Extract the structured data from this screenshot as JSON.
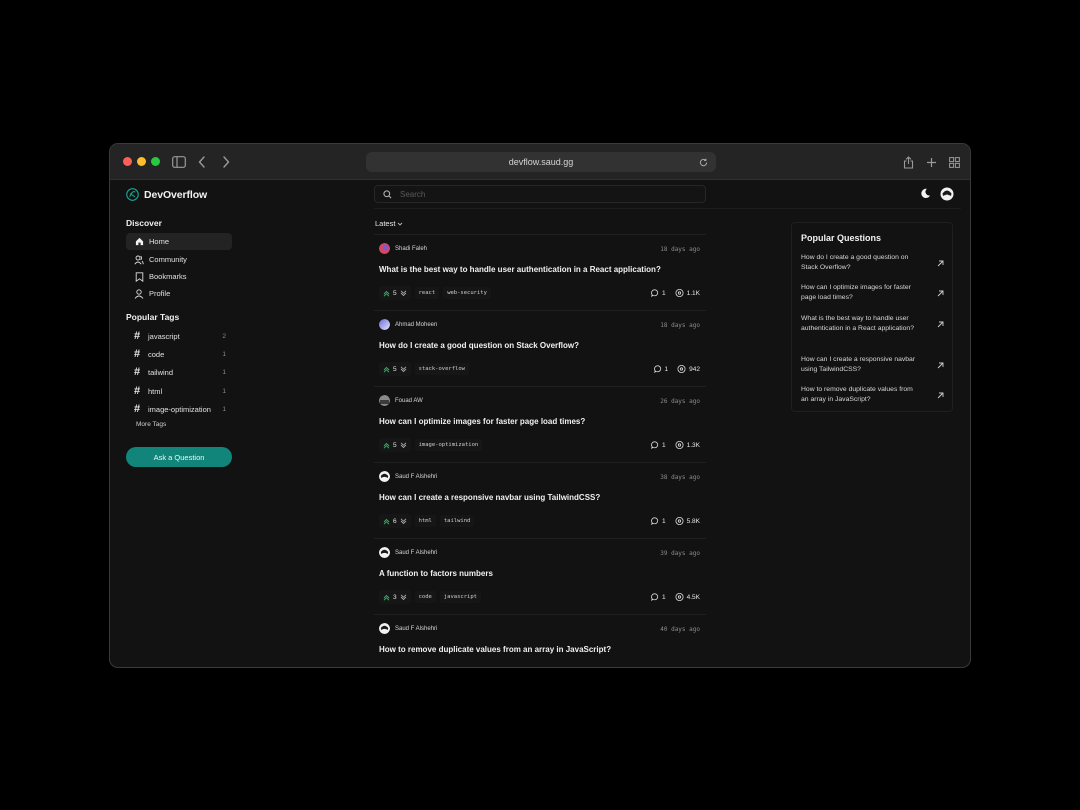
{
  "browser": {
    "url": "devflow.saud.gg"
  },
  "app": {
    "name": "DevOverflow",
    "search_placeholder": "Search"
  },
  "sidebar": {
    "discover_heading": "Discover",
    "nav": [
      {
        "label": "Home",
        "icon": "home-icon",
        "active": true
      },
      {
        "label": "Community",
        "icon": "users-icon",
        "active": false
      },
      {
        "label": "Bookmarks",
        "icon": "bookmark-icon",
        "active": false
      },
      {
        "label": "Profile",
        "icon": "user-icon",
        "active": false
      }
    ],
    "tags_heading": "Popular Tags",
    "tags": [
      {
        "name": "javascript",
        "count": "2"
      },
      {
        "name": "code",
        "count": "1"
      },
      {
        "name": "tailwind",
        "count": "1"
      },
      {
        "name": "html",
        "count": "1"
      },
      {
        "name": "image-optimization",
        "count": "1"
      }
    ],
    "more_tags": "More Tags",
    "ask_button": "Ask a Question"
  },
  "feed": {
    "sort_label": "Latest",
    "questions": [
      {
        "author": "Shadi Faleh",
        "date": "18 days ago",
        "title": "What is the best way to handle user authentication in a React application?",
        "votes": "5",
        "tags": [
          "react",
          "web-security"
        ],
        "answers": "1",
        "views": "1.1K"
      },
      {
        "author": "Ahmad Moheen",
        "date": "18 days ago",
        "title": "How do I create a good question on Stack Overflow?",
        "votes": "5",
        "tags": [
          "stack-overflow"
        ],
        "answers": "1",
        "views": "942"
      },
      {
        "author": "Fouad AW",
        "date": "26 days ago",
        "title": "How can I optimize images for faster page load times?",
        "votes": "5",
        "tags": [
          "image-optimization"
        ],
        "answers": "1",
        "views": "1.3K"
      },
      {
        "author": "Saud F Alshehri",
        "date": "38 days ago",
        "title": "How can I create a responsive navbar using TailwindCSS?",
        "votes": "6",
        "tags": [
          "html",
          "tailwind"
        ],
        "answers": "1",
        "views": "5.8K"
      },
      {
        "author": "Saud F Alshehri",
        "date": "39 days ago",
        "title": "A function to factors numbers",
        "votes": "3",
        "tags": [
          "code",
          "javascript"
        ],
        "answers": "1",
        "views": "4.5K"
      },
      {
        "author": "Saud F Alshehri",
        "date": "40 days ago",
        "title": "How to remove duplicate values from an array in JavaScript?"
      }
    ]
  },
  "popular_questions": {
    "heading": "Popular Questions",
    "items": [
      "How do I create a good question on Stack Overflow?",
      "How can I optimize images for faster page load times?",
      "What is the best way to handle user authentication in a React application?",
      "How can I create a responsive navbar using TailwindCSS?",
      "How to remove duplicate values from an array in JavaScript?"
    ]
  },
  "colors": {
    "accent": "#11857a",
    "vote_up": "#22c55e",
    "background": "#121212"
  }
}
